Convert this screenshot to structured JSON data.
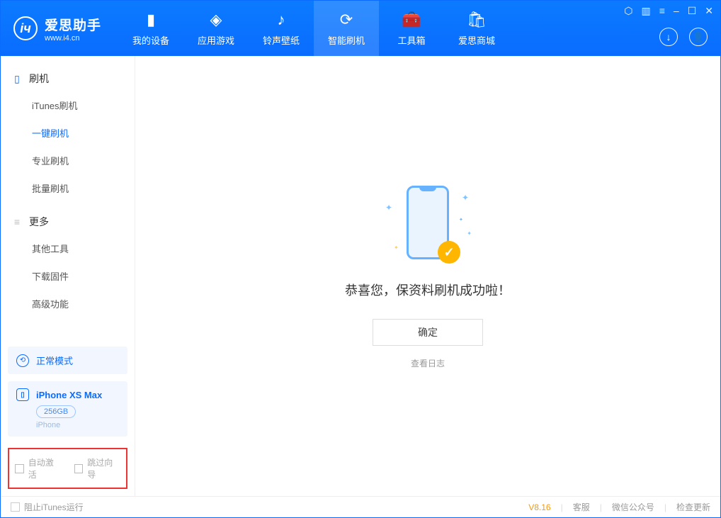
{
  "app": {
    "title": "爱思助手",
    "subtitle": "www.i4.cn"
  },
  "topTabs": {
    "device": "我的设备",
    "apps": "应用游戏",
    "ringtone": "铃声壁纸",
    "flash": "智能刷机",
    "toolbox": "工具箱",
    "store": "爱思商城"
  },
  "sidebar": {
    "group1": {
      "title": "刷机",
      "items": {
        "itunes": "iTunes刷机",
        "oneclick": "一键刷机",
        "pro": "专业刷机",
        "batch": "批量刷机"
      }
    },
    "group2": {
      "title": "更多",
      "items": {
        "other": "其他工具",
        "firmware": "下载固件",
        "advanced": "高级功能"
      }
    }
  },
  "mode": {
    "label": "正常模式"
  },
  "device": {
    "name": "iPhone XS Max",
    "storage": "256GB",
    "type": "iPhone"
  },
  "checkboxes": {
    "auto_activate": "自动激活",
    "skip_guide": "跳过向导"
  },
  "main": {
    "success_title": "恭喜您，保资料刷机成功啦！",
    "ok": "确定",
    "view_log": "查看日志"
  },
  "footer": {
    "block_itunes": "阻止iTunes运行",
    "version": "V8.16",
    "service": "客服",
    "wechat": "微信公众号",
    "update": "检查更新"
  }
}
